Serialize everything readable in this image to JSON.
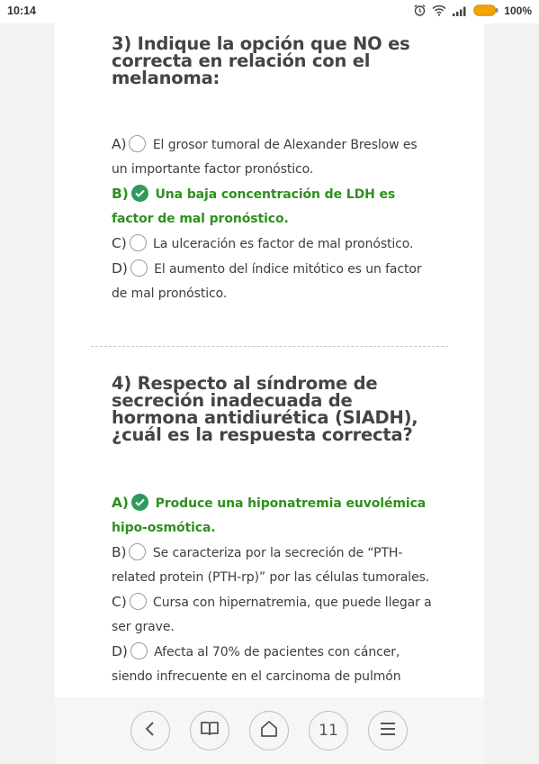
{
  "status_bar": {
    "time": "10:14",
    "battery_percent": "100%",
    "icons": [
      "alarm-icon",
      "wifi-icon",
      "signal-icon",
      "battery-icon"
    ],
    "battery_color": "#f0a500"
  },
  "questions": [
    {
      "title": "3) Indique la opción que NO es correcta en relación con el melanoma:",
      "options": [
        {
          "letter": "A)",
          "text": "El grosor tumoral de Alexander Breslow es un importante factor pronóstico.",
          "correct": false
        },
        {
          "letter": "B)",
          "text": "Una baja concentración de LDH es factor de mal pronóstico.",
          "correct": true
        },
        {
          "letter": "C)",
          "text": "La ulceración es factor de mal pronóstico.",
          "correct": false
        },
        {
          "letter": "D)",
          "text": "El aumento del índice mitótico es un factor de mal pronóstico.",
          "correct": false
        }
      ]
    },
    {
      "title": "4) Respecto al síndrome de secreción inadecuada de hormona antidiurética (SIADH), ¿cuál es la respuesta correcta?",
      "options": [
        {
          "letter": "A)",
          "text": "Produce una hiponatremia euvolémica hipo-osmótica.",
          "correct": true
        },
        {
          "letter": "B)",
          "text": "Se caracteriza por la secreción de “PTH-related protein (PTH-rp)” por las células tumorales.",
          "correct": false
        },
        {
          "letter": "C)",
          "text": "Cursa con hipernatremia, que puede llegar a ser grave.",
          "correct": false
        },
        {
          "letter": "D)",
          "text": "Afecta al 70% de pacientes con cáncer, siendo infrecuente en el carcinoma de pulmón",
          "correct": false
        }
      ]
    }
  ],
  "colors": {
    "correct_text": "#2f8f1f",
    "check_fill": "#2e9a5e"
  },
  "bottom_nav": {
    "back_icon": "chevron-left-icon",
    "reader_icon": "book-icon",
    "home_icon": "home-icon",
    "tabs_count": "11",
    "menu_icon": "menu-icon"
  }
}
